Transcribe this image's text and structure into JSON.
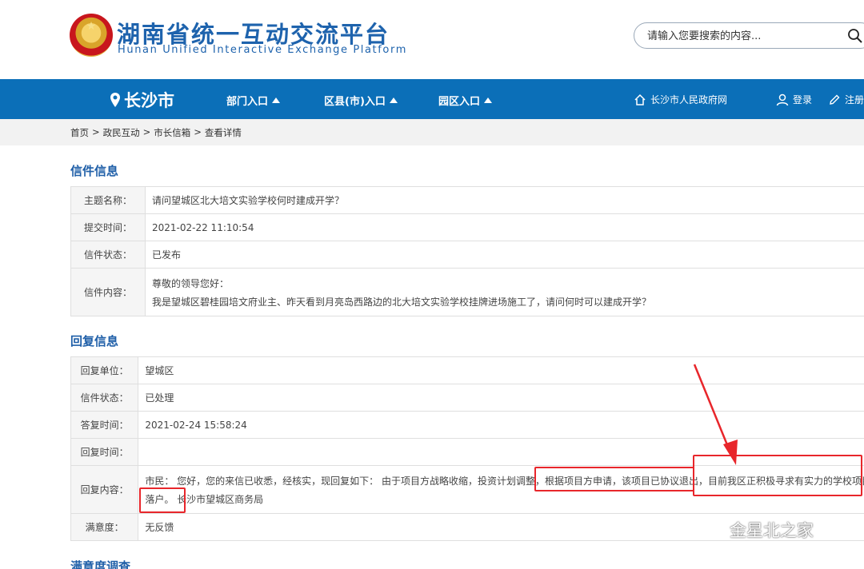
{
  "header": {
    "title": "湖南省统一互动交流平台",
    "subtitle": "Hunan Unified Interactive Exchange Platform",
    "search_placeholder": "请输入您要搜索的内容..."
  },
  "nav": {
    "city": "长沙市",
    "items": [
      "部门入口",
      "区县(市)入口",
      "园区入口"
    ],
    "gov_link": "长沙市人民政府网",
    "login": "登录",
    "register": "注册"
  },
  "breadcrumb": [
    "首页",
    ">",
    "政民互动",
    ">",
    "市长信箱",
    ">",
    "查看详情"
  ],
  "letter": {
    "section_title": "信件信息",
    "rows": [
      {
        "label": "主题名称：",
        "value": "请问望城区北大培文实验学校何时建成开学？"
      },
      {
        "label": "提交时间：",
        "value": "2021-02-22 11:10:54"
      },
      {
        "label": "信件状态：",
        "value": "已发布"
      }
    ],
    "content_label": "信件内容：",
    "content_line1": "尊敬的领导您好：",
    "content_line2": "我是望城区碧桂园培文府业主、昨天看到月亮岛西路边的北大培文实验学校挂牌进场施工了，请问何时可以建成开学？"
  },
  "reply": {
    "section_title": "回复信息",
    "rows": [
      {
        "label": "回复单位：",
        "value": "望城区"
      },
      {
        "label": "信件状态：",
        "value": "已处理"
      },
      {
        "label": "答复时间：",
        "value": "2021-02-24 15:58:24"
      },
      {
        "label": "回复时间：",
        "value": ""
      }
    ],
    "content_label": "回复内容：",
    "content_line1": "市民： 您好，您的来信已收悉，经核实，现回复如下： 由于项目方战略收缩，投资计划调整，根据项目方申请，该项目已协议退出，目前我区正积极寻求有实力的学校项目",
    "content_line2": "落户。 长沙市望城区商务局",
    "satisfaction_label": "满意度：",
    "satisfaction_value": "无反馈"
  },
  "survey": {
    "section_title": "满意度调查"
  },
  "watermark": "金星北之家",
  "colors": {
    "brand_blue": "#0b6fb8",
    "title_blue": "#1e63ad",
    "annotation_red": "#e8262b"
  }
}
